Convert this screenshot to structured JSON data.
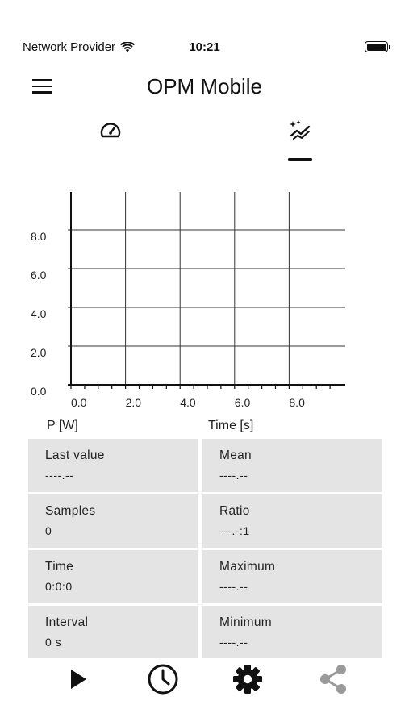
{
  "status_bar": {
    "provider": "Network Provider",
    "time": "10:21",
    "icons": [
      "wifi-icon",
      "battery-icon"
    ]
  },
  "app_bar": {
    "title": "OPM Mobile",
    "menu_icon": "hamburger-menu-icon"
  },
  "tabs": [
    {
      "icon": "gauge-icon",
      "selected": false
    },
    {
      "icon": "chart-sparkle-icon",
      "selected": true
    }
  ],
  "chart_data": {
    "type": "line",
    "series": [],
    "x_ticks": [
      "0.0",
      "2.0",
      "4.0",
      "6.0",
      "8.0"
    ],
    "y_ticks": [
      "0.0",
      "2.0",
      "4.0",
      "6.0",
      "8.0"
    ],
    "xlim": [
      0,
      10
    ],
    "ylim": [
      0,
      10
    ],
    "ylabel": "P [W]",
    "xlabel": "Time [s]",
    "grid": true
  },
  "stats": [
    {
      "label": "Last value",
      "value": "----.--"
    },
    {
      "label": "Mean",
      "value": "----.--"
    },
    {
      "label": "Samples",
      "value": "0"
    },
    {
      "label": "Ratio",
      "value": "---.-:1"
    },
    {
      "label": "Time",
      "value": "0:0:0"
    },
    {
      "label": "Maximum",
      "value": "----.--"
    },
    {
      "label": "Interval",
      "value": "0 s"
    },
    {
      "label": "Minimum",
      "value": "----.--"
    }
  ],
  "bottom_nav": [
    {
      "icon": "play-icon",
      "enabled": true
    },
    {
      "icon": "clock-icon",
      "enabled": true
    },
    {
      "icon": "gear-icon",
      "enabled": true
    },
    {
      "icon": "share-icon",
      "enabled": false
    }
  ],
  "colors": {
    "text": "#111111",
    "cell_background": "#e4e4e4",
    "disabled_icon": "#9a9a9a"
  }
}
